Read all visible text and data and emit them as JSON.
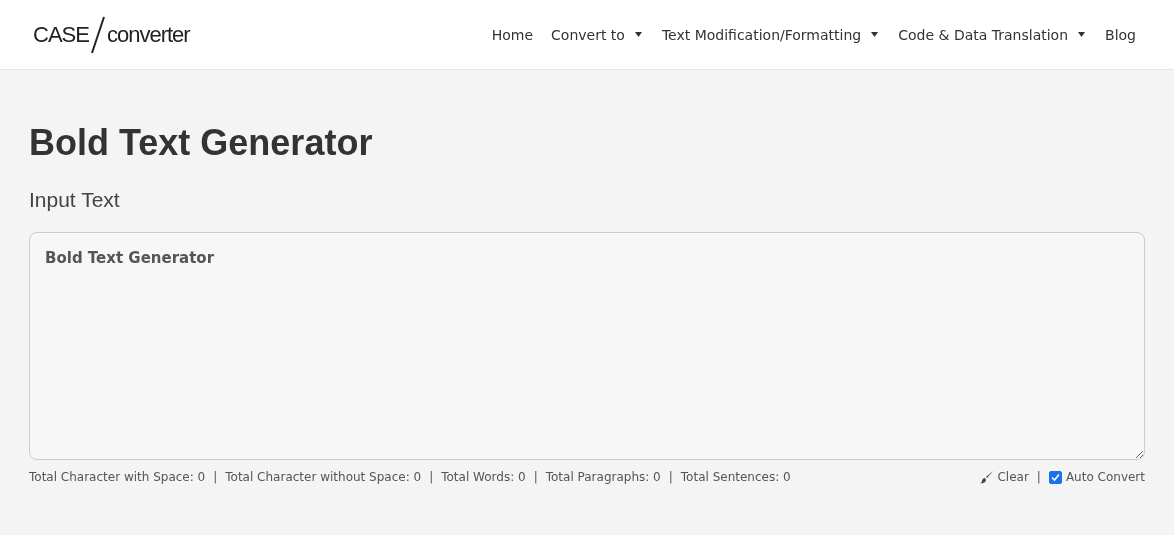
{
  "logo": {
    "left": "CASE",
    "right": "converter"
  },
  "nav": [
    {
      "label": "Home",
      "dropdown": false
    },
    {
      "label": "Convert to",
      "dropdown": true
    },
    {
      "label": "Text Modification/Formatting",
      "dropdown": true
    },
    {
      "label": "Code & Data Translation",
      "dropdown": true
    },
    {
      "label": "Blog",
      "dropdown": false
    }
  ],
  "page_title": "Bold Text Generator",
  "input_label": "Input Text",
  "input": {
    "value": "Bold Text Generator"
  },
  "separator": "|",
  "stats": [
    "Total Character with Space: 0",
    "Total Character without Space: 0",
    "Total Words: 0",
    "Total Paragraphs: 0",
    "Total Sentences: 0"
  ],
  "clear_label": "Clear",
  "auto_convert": {
    "label": "Auto Convert",
    "checked": true
  }
}
